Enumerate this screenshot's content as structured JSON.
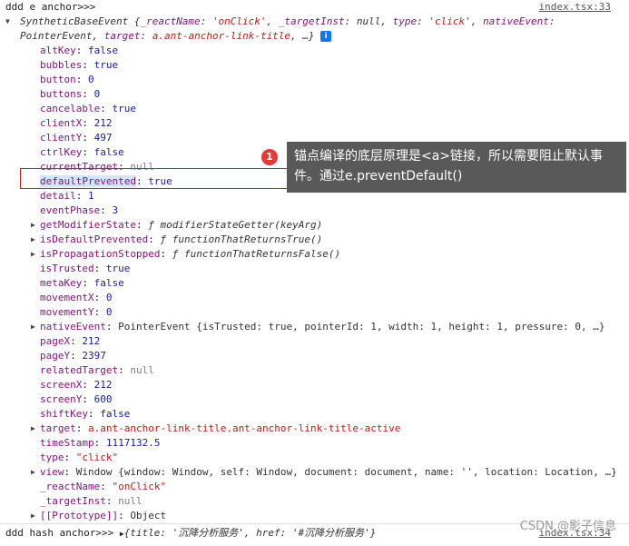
{
  "log": {
    "header": "ddd e anchor>>>",
    "source": "index.tsx:33",
    "summary": {
      "prefix": "SyntheticBaseEvent {",
      "k1": "_reactName",
      "v1": "'onClick'",
      "k2": "_targetInst",
      "v2": "null",
      "k3": "type",
      "v3": "'click'",
      "k4": "nativeEvent",
      "v4": "PointerEvent",
      "k5": "target",
      "v5": "a.ant-anchor-link-title",
      "suffix": "…}",
      "info_icon": "i"
    }
  },
  "properties": [
    {
      "key": "altKey",
      "value": "false",
      "kind": "bool",
      "expandable": false
    },
    {
      "key": "bubbles",
      "value": "true",
      "kind": "bool",
      "expandable": false
    },
    {
      "key": "button",
      "value": "0",
      "kind": "num",
      "expandable": false
    },
    {
      "key": "buttons",
      "value": "0",
      "kind": "num",
      "expandable": false
    },
    {
      "key": "cancelable",
      "value": "true",
      "kind": "bool",
      "expandable": false
    },
    {
      "key": "clientX",
      "value": "212",
      "kind": "num",
      "expandable": false
    },
    {
      "key": "clientY",
      "value": "497",
      "kind": "num",
      "expandable": false
    },
    {
      "key": "ctrlKey",
      "value": "false",
      "kind": "bool",
      "expandable": false
    },
    {
      "key": "currentTarget",
      "value": "null",
      "kind": "null",
      "expandable": false
    },
    {
      "key": "defaultPrevented",
      "value": "true",
      "kind": "bool",
      "expandable": false,
      "highlighted": true
    },
    {
      "key": "detail",
      "value": "1",
      "kind": "num",
      "expandable": false
    },
    {
      "key": "eventPhase",
      "value": "3",
      "kind": "num",
      "expandable": false
    },
    {
      "key": "getModifierState",
      "value": "ƒ modifierStateGetter(keyArg)",
      "kind": "fn",
      "expandable": true
    },
    {
      "key": "isDefaultPrevented",
      "value": "ƒ functionThatReturnsTrue()",
      "kind": "fn",
      "expandable": true
    },
    {
      "key": "isPropagationStopped",
      "value": "ƒ functionThatReturnsFalse()",
      "kind": "fn",
      "expandable": true
    },
    {
      "key": "isTrusted",
      "value": "true",
      "kind": "bool",
      "expandable": false
    },
    {
      "key": "metaKey",
      "value": "false",
      "kind": "bool",
      "expandable": false
    },
    {
      "key": "movementX",
      "value": "0",
      "kind": "num",
      "expandable": false
    },
    {
      "key": "movementY",
      "value": "0",
      "kind": "num",
      "expandable": false
    },
    {
      "key": "nativeEvent",
      "value": "PointerEvent {isTrusted: true, pointerId: 1, width: 1, height: 1, pressure: 0, …}",
      "kind": "obj",
      "expandable": true
    },
    {
      "key": "pageX",
      "value": "212",
      "kind": "num",
      "expandable": false
    },
    {
      "key": "pageY",
      "value": "2397",
      "kind": "num",
      "expandable": false
    },
    {
      "key": "relatedTarget",
      "value": "null",
      "kind": "null",
      "expandable": false
    },
    {
      "key": "screenX",
      "value": "212",
      "kind": "num",
      "expandable": false
    },
    {
      "key": "screenY",
      "value": "600",
      "kind": "num",
      "expandable": false
    },
    {
      "key": "shiftKey",
      "value": "false",
      "kind": "bool",
      "expandable": false
    },
    {
      "key": "target",
      "value": "a.ant-anchor-link-title.ant-anchor-link-title-active",
      "kind": "str",
      "expandable": true
    },
    {
      "key": "timeStamp",
      "value": "1117132.5",
      "kind": "num",
      "expandable": false
    },
    {
      "key": "type",
      "value": "\"click\"",
      "kind": "str",
      "expandable": false
    },
    {
      "key": "view",
      "value": "Window {window: Window, self: Window, document: document, name: '', location: Location, …}",
      "kind": "obj",
      "expandable": true
    },
    {
      "key": "_reactName",
      "value": "\"onClick\"",
      "kind": "str",
      "expandable": false
    },
    {
      "key": "_targetInst",
      "value": "null",
      "kind": "null",
      "expandable": false
    },
    {
      "key": "[[Prototype]]",
      "value": "Object",
      "kind": "obj",
      "expandable": true
    }
  ],
  "footer": {
    "text": "ddd hash anchor>>>",
    "object": "{title: '沉降分析服务', href: '#沉降分析服务'}",
    "source": "index.tsx:34"
  },
  "annotation": {
    "marker": "1",
    "text": "锚点编译的底层原理是<a>链接，所以需要阻止默认事件。通过e.preventDefault()"
  },
  "watermark": "CSDN @影子信息",
  "colors": {
    "key": "#881280",
    "bool_num": "#1a1aa6",
    "string": "#c41a16",
    "highlight_box": "#d02020",
    "tooltip_bg": "#595959",
    "marker_bg": "#e53935"
  }
}
